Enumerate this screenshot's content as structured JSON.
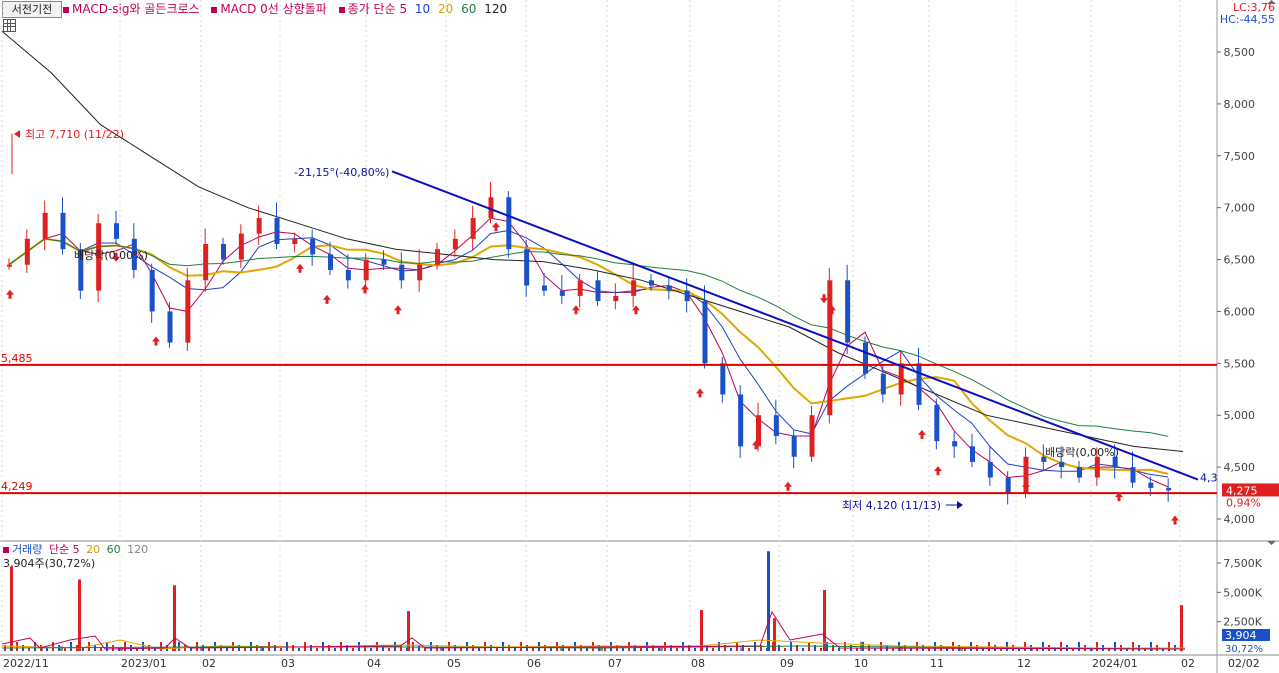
{
  "header": {
    "button_label": "서전기전",
    "items": [
      {
        "text": "MACD-sig와 골든크로스",
        "color": "#c0005a"
      },
      {
        "text": "MACD 0선 상향돌파",
        "color": "#c0005a"
      },
      {
        "text": "종가 단순 5",
        "color": "#c0005a"
      },
      {
        "text": "10",
        "color": "#2040c0"
      },
      {
        "text": "20",
        "color": "#d4a000"
      },
      {
        "text": "60",
        "color": "#208040"
      },
      {
        "text": "120",
        "color": "#222222"
      }
    ]
  },
  "price_axis": {
    "lc": "LC:3,76",
    "hc": "HC:-44,55",
    "ticks": [
      "8,500",
      "8,000",
      "7,500",
      "7,000",
      "6,500",
      "6,000",
      "5,500",
      "5,000",
      "4,500",
      "4,000"
    ],
    "current_price": "4,275",
    "current_change": "0,94%"
  },
  "annotations": {
    "high_label": "최고 7,710 (11/22)",
    "low_label": "최저 4,120 (11/13)",
    "trend_label": "-21,15°(-40,80%)",
    "trend_end_label": "4,3",
    "dividend_1": "배당락(0,00%)",
    "dividend_2": "배당락(0,00%)",
    "hline_1": "5,485",
    "hline_2": "4,249"
  },
  "volume_panel": {
    "title": "거래량",
    "ma_items": [
      {
        "text": "단순 5",
        "color": "#c0005a"
      },
      {
        "text": "20",
        "color": "#d4a000"
      },
      {
        "text": "60",
        "color": "#208040"
      },
      {
        "text": "120",
        "color": "#888888"
      }
    ],
    "current_label": "3,904주(30,72%)",
    "ticks": [
      "7,500K",
      "5,000K",
      "2,500K"
    ],
    "current_value": "3,904",
    "current_pct": "30,72%"
  },
  "x_axis": {
    "labels": [
      "2022/11",
      "2023/01",
      "02",
      "03",
      "04",
      "05",
      "06",
      "07",
      "08",
      "09",
      "10",
      "11",
      "12",
      "2024/01",
      "02"
    ],
    "right_label": "02/02"
  },
  "colors": {
    "up": "#e02020",
    "down": "#1a50c8",
    "ma5": "#c0005a",
    "ma10": "#2040c0",
    "ma20": "#e0a800",
    "ma60": "#208040",
    "ma120": "#222222",
    "trend": "#0a10c0",
    "hline": "#e00000"
  },
  "chart_data": {
    "type": "candlestick",
    "title": "서전기전",
    "price_range": [
      3750,
      8950
    ],
    "volume_range_k": [
      0,
      9000
    ],
    "x_months": [
      "2022/11",
      "2023/01",
      "02",
      "03",
      "04",
      "05",
      "06",
      "07",
      "08",
      "09",
      "10",
      "11",
      "12",
      "2024/01",
      "02"
    ],
    "horizontal_lines": [
      5485,
      4249
    ],
    "high": {
      "value": 7710,
      "date": "11/22"
    },
    "low": {
      "value": 4120,
      "date": "11/13"
    },
    "trendline": {
      "from": {
        "date": "2023/04",
        "value": 7350
      },
      "to": {
        "date": "2024/02",
        "value": 4380
      },
      "label": "-21,15°(-40,80%)"
    },
    "close_series": [
      6450,
      6700,
      6950,
      6600,
      6200,
      6850,
      6700,
      6400,
      6000,
      5700,
      6300,
      6650,
      6500,
      6750,
      6900,
      6650,
      6700,
      6550,
      6400,
      6300,
      6500,
      6450,
      6300,
      6450,
      6600,
      6700,
      6900,
      7100,
      6600,
      6250,
      6200,
      6150,
      6300,
      6100,
      6150,
      6300,
      6250,
      6200,
      6100,
      5500,
      5200,
      4700,
      5000,
      4800,
      4600,
      5000,
      6300,
      5700,
      5400,
      5200,
      5500,
      5100,
      4750,
      4700,
      4550,
      4400,
      4250,
      4600,
      4550,
      4500,
      4400,
      4600,
      4500,
      4350,
      4300,
      4275
    ],
    "ma120_series": [
      8700,
      8300,
      7800,
      7500,
      7200,
      7000,
      6850,
      6700,
      6600,
      6550,
      6500,
      6480,
      6400,
      6300,
      6150,
      6000,
      5850,
      5600,
      5400,
      5200,
      5000,
      4900,
      4800,
      4700,
      4650
    ],
    "volume_k": [
      7200,
      300,
      400,
      6100,
      300,
      5600,
      300,
      300,
      3400,
      300,
      300,
      300,
      300,
      300,
      3500,
      300,
      8500,
      2800,
      5200,
      800,
      300,
      300,
      300,
      300,
      300,
      3904
    ]
  }
}
